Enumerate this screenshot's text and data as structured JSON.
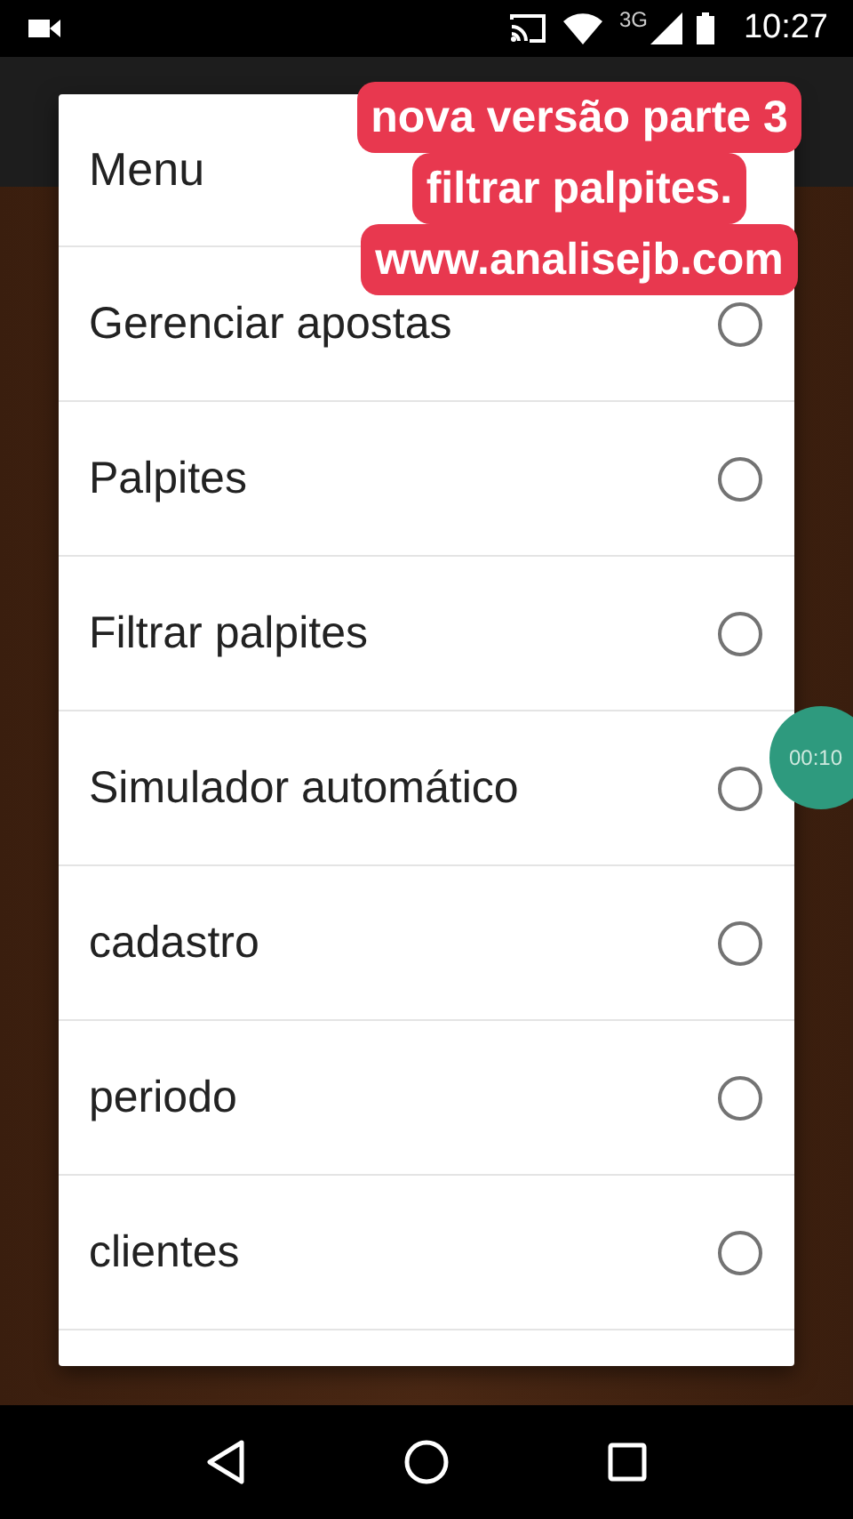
{
  "status_bar": {
    "time": "10:27",
    "network": "3G"
  },
  "dialog": {
    "title": "Menu",
    "items": [
      {
        "label": "Gerenciar apostas",
        "selected": false
      },
      {
        "label": "Palpites",
        "selected": false
      },
      {
        "label": "Filtrar palpites",
        "selected": false
      },
      {
        "label": "Simulador automático",
        "selected": false
      },
      {
        "label": "cadastro",
        "selected": false
      },
      {
        "label": "periodo",
        "selected": false
      },
      {
        "label": "clientes",
        "selected": false
      }
    ]
  },
  "caption": {
    "lines": [
      "nova versão parte 3",
      "filtrar palpites.",
      "www.analisejb.com"
    ]
  },
  "recording_timer": "00:10"
}
